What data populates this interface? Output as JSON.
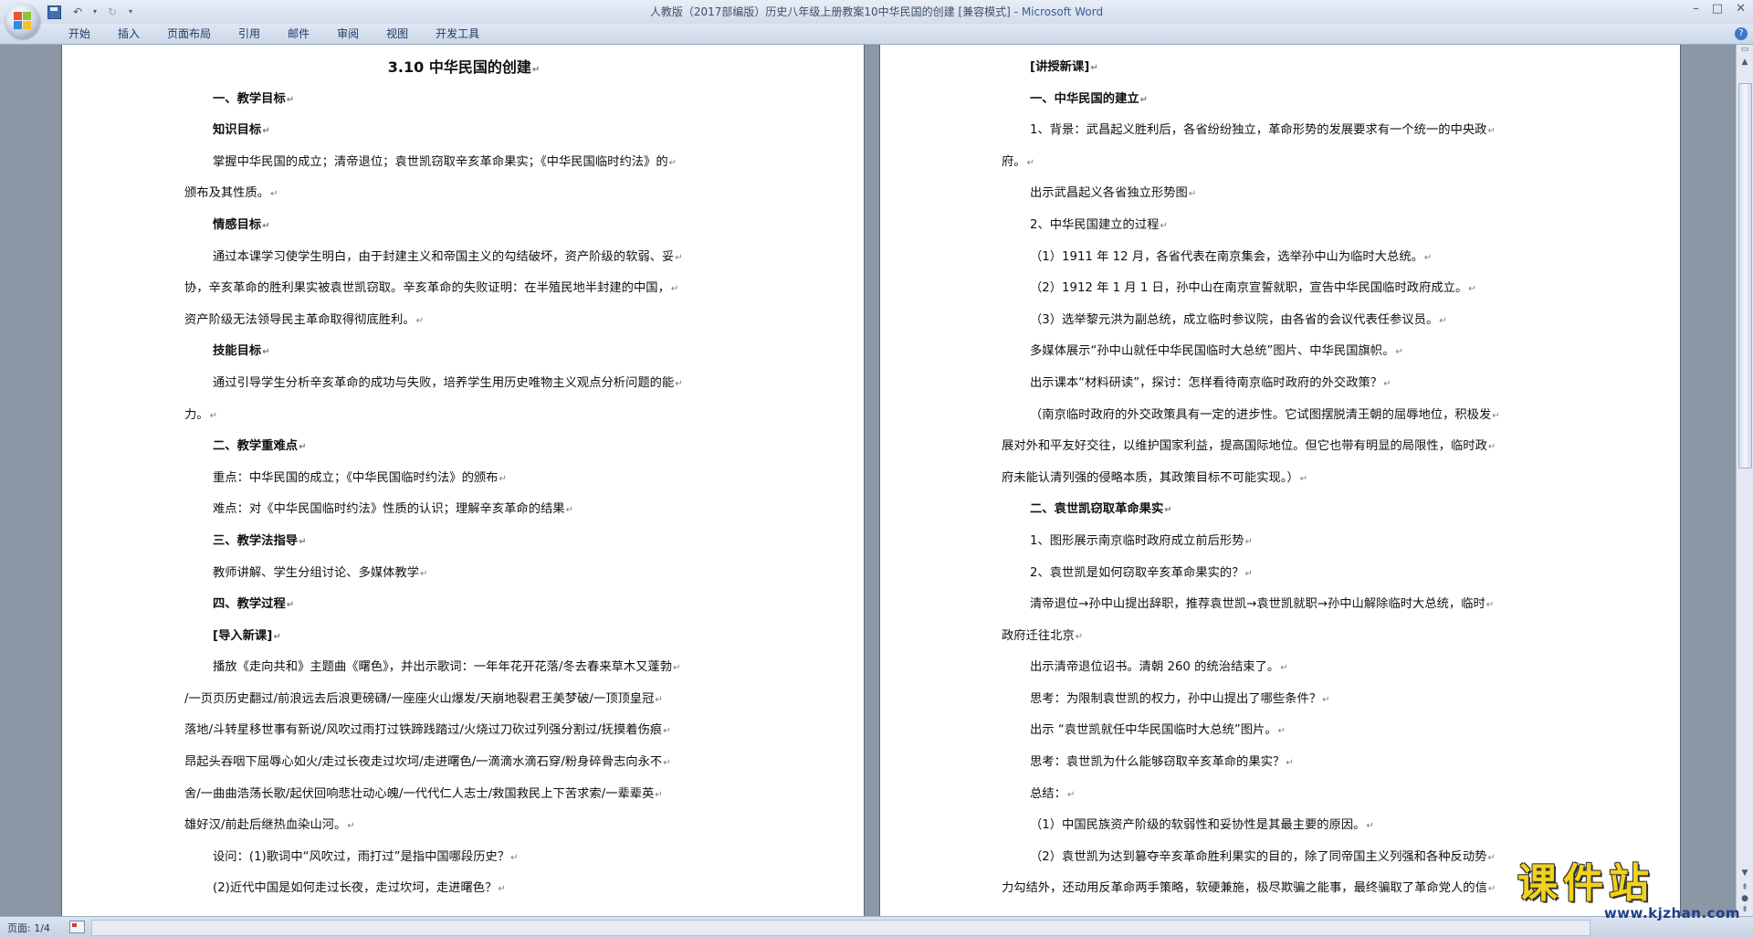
{
  "window": {
    "title": "人教版（2017部编版）历史八年级上册教案10中华民国的创建 [兼容模式] - ",
    "app_name": "Microsoft Word"
  },
  "ribbon": {
    "tabs": [
      "开始",
      "插入",
      "页面布局",
      "引用",
      "邮件",
      "审阅",
      "视图",
      "开发工具"
    ]
  },
  "status": {
    "page": "页面: 1/4"
  },
  "watermark": {
    "main": "课件站",
    "url": "www.kjzhan.com"
  },
  "doc": {
    "left_page": {
      "title": "3.10  中华民国的创建",
      "lines": [
        {
          "text": "一、教学目标",
          "style": "bold"
        },
        {
          "text": "知识目标",
          "style": "bold"
        },
        {
          "text": "掌握中华民国的成立；清帝退位；袁世凯窃取辛亥革命果实；《中华民国临时约法》的",
          "style": "indent"
        },
        {
          "text": "颁布及其性质。",
          "style": "plain"
        },
        {
          "text": "情感目标",
          "style": "bold"
        },
        {
          "text": "通过本课学习使学生明白，由于封建主义和帝国主义的勾结破坏，资产阶级的软弱、妥",
          "style": "indent"
        },
        {
          "text": "协，辛亥革命的胜利果实被袁世凯窃取。辛亥革命的失败证明：在半殖民地半封建的中国，",
          "style": "plain"
        },
        {
          "text": "资产阶级无法领导民主革命取得彻底胜利。",
          "style": "plain"
        },
        {
          "text": "技能目标",
          "style": "bold"
        },
        {
          "text": "通过引导学生分析辛亥革命的成功与失败，培养学生用历史唯物主义观点分析问题的能",
          "style": "indent"
        },
        {
          "text": "力。",
          "style": "plain"
        },
        {
          "text": "二、教学重难点",
          "style": "bold"
        },
        {
          "text": "重点：中华民国的成立；《中华民国临时约法》的颁布",
          "style": "indent"
        },
        {
          "text": "难点：对《中华民国临时约法》性质的认识；理解辛亥革命的结果",
          "style": "indent"
        },
        {
          "text": "三、教学法指导",
          "style": "bold"
        },
        {
          "text": "教师讲解、学生分组讨论、多媒体教学",
          "style": "indent"
        },
        {
          "text": "四、教学过程",
          "style": "bold"
        },
        {
          "text": "[导入新课]",
          "style": "bold"
        },
        {
          "text": "播放《走向共和》主题曲《曙色》，并出示歌词：一年年花开花落/冬去春来草木又蓬勃",
          "style": "indent"
        },
        {
          "text": "/一页页历史翻过/前浪远去后浪更磅礴/一座座火山爆发/天崩地裂君王美梦破/一顶顶皇冠",
          "style": "plain"
        },
        {
          "text": "落地/斗转星移世事有新说/风吹过雨打过铁蹄践踏过/火烧过刀砍过列强分割过/抚摸着伤痕",
          "style": "plain"
        },
        {
          "text": "昂起头吞咽下屈辱心如火/走过长夜走过坎坷/走进曙色/一滴滴水滴石穿/粉身碎骨志向永不",
          "style": "plain"
        },
        {
          "text": "舍/一曲曲浩荡长歌/起伏回响悲壮动心魄/一代代仁人志士/救国救民上下苦求索/一辈辈英",
          "style": "plain"
        },
        {
          "text": "雄好汉/前赴后继热血染山河。",
          "style": "plain"
        },
        {
          "text": "设问：(1)歌词中“风吹过，雨打过”是指中国哪段历史？",
          "style": "indent"
        },
        {
          "text": "(2)近代中国是如何走过长夜，走过坎坷，走进曙色？",
          "style": "indent"
        }
      ]
    },
    "right_page": {
      "lines": [
        {
          "text": "[讲授新课]",
          "style": "bold"
        },
        {
          "text": "一、中华民国的建立",
          "style": "bold"
        },
        {
          "text": "1、背景：武昌起义胜利后，各省纷纷独立，革命形势的发展要求有一个统一的中央政",
          "style": "indent"
        },
        {
          "text": "府。",
          "style": "plain"
        },
        {
          "text": "出示武昌起义各省独立形势图",
          "style": "indent"
        },
        {
          "text": "2、中华民国建立的过程",
          "style": "indent"
        },
        {
          "text": "（1）1911 年 12 月，各省代表在南京集会，选举孙中山为临时大总统。",
          "style": "indent"
        },
        {
          "text": "（2）1912 年 1 月 1 日，孙中山在南京宣誓就职，宣告中华民国临时政府成立。",
          "style": "indent"
        },
        {
          "text": "（3）选举黎元洪为副总统，成立临时参议院，由各省的会议代表任参议员。",
          "style": "indent"
        },
        {
          "text": "多媒体展示“孙中山就任中华民国临时大总统”图片、中华民国旗帜。",
          "style": "indent"
        },
        {
          "text": "出示课本“材料研读”，探讨：怎样看待南京临时政府的外交政策？",
          "style": "indent"
        },
        {
          "text": "（南京临时政府的外交政策具有一定的进步性。它试图摆脱清王朝的屈辱地位，积极发",
          "style": "indent"
        },
        {
          "text": "展对外和平友好交往，以维护国家利益，提高国际地位。但它也带有明显的局限性，临时政",
          "style": "plain"
        },
        {
          "text": "府未能认清列强的侵略本质，其政策目标不可能实现。）",
          "style": "plain"
        },
        {
          "text": "二、袁世凯窃取革命果实",
          "style": "bold"
        },
        {
          "text": "1、图形展示南京临时政府成立前后形势",
          "style": "indent"
        },
        {
          "text": "2、袁世凯是如何窃取辛亥革命果实的？",
          "style": "indent"
        },
        {
          "text": "清帝退位→孙中山提出辞职，推荐袁世凯→袁世凯就职→孙中山解除临时大总统，临时",
          "style": "indent"
        },
        {
          "text": "政府迁往北京",
          "style": "plain"
        },
        {
          "text": "出示清帝退位诏书。清朝 260 的统治结束了。",
          "style": "indent"
        },
        {
          "text": "思考：为限制袁世凯的权力，孙中山提出了哪些条件？",
          "style": "indent"
        },
        {
          "text": "出示 “袁世凯就任中华民国临时大总统”图片。",
          "style": "indent"
        },
        {
          "text": "思考：袁世凯为什么能够窃取辛亥革命的果实？",
          "style": "indent"
        },
        {
          "text": "总结：",
          "style": "indent"
        },
        {
          "text": "（1）中国民族资产阶级的软弱性和妥协性是其最主要的原因。",
          "style": "indent"
        },
        {
          "text": "（2）袁世凯为达到篡夺辛亥革命胜利果实的目的，除了同帝国主义列强和各种反动势",
          "style": "indent"
        },
        {
          "text": "力勾结外，还动用反革命两手策略，软硬兼施，极尽欺骗之能事，最终骗取了革命党人的信",
          "style": "plain"
        }
      ]
    }
  }
}
